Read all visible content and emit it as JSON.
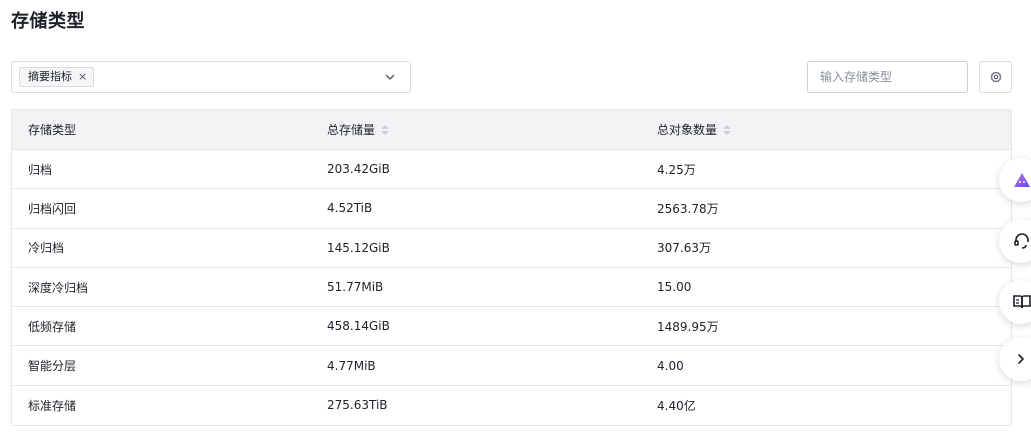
{
  "page": {
    "title": "存储类型"
  },
  "filter": {
    "tag_label": "摘要指标",
    "tag_close": "×"
  },
  "search": {
    "placeholder": "输入存储类型"
  },
  "table": {
    "headers": [
      "存储类型",
      "总存储量",
      "总对象数量"
    ],
    "rows": [
      [
        "归档",
        "203.42GiB",
        "4.25万"
      ],
      [
        "归档闪回",
        "4.52TiB",
        "2563.78万"
      ],
      [
        "冷归档",
        "145.12GiB",
        "307.63万"
      ],
      [
        "深度冷归档",
        "51.77MiB",
        "15.00"
      ],
      [
        "低频存储",
        "458.14GiB",
        "1489.95万"
      ],
      [
        "智能分层",
        "4.77MiB",
        "4.00"
      ],
      [
        "标准存储",
        "275.63TiB",
        "4.40亿"
      ]
    ]
  },
  "icons": {
    "select_arrow": "chevron-down-icon",
    "settings": "gear-icon",
    "float_1": "ai-assistant-icon",
    "float_2": "headset-icon",
    "float_3": "book-icon",
    "float_4": "chevron-right-icon"
  },
  "colors": {
    "accent": "#7b61ff",
    "text": "#1d2129",
    "border": "#e5e6eb",
    "header_bg": "#f2f3f5"
  }
}
